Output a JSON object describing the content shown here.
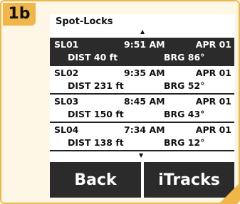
{
  "step": {
    "label": "1b"
  },
  "screen": {
    "title": "Spot-Locks",
    "rows": [
      {
        "id": "SL01",
        "time": "9:51 AM",
        "date": "APR 01",
        "dist": "DIST 40 ft",
        "brg": "BRG 86°",
        "selected": true
      },
      {
        "id": "SL02",
        "time": "9:35 AM",
        "date": "APR 01",
        "dist": "DIST 231 ft",
        "brg": "BRG 52°",
        "selected": false
      },
      {
        "id": "SL03",
        "time": "8:45 AM",
        "date": "APR 01",
        "dist": "DIST 150 ft",
        "brg": "BRG 43°",
        "selected": false
      },
      {
        "id": "SL04",
        "time": "7:34 AM",
        "date": "APR 01",
        "dist": "DIST 138 ft",
        "brg": "BRG 12°",
        "selected": false
      }
    ]
  },
  "softkeys": {
    "back_label": "Back",
    "itracks_label": "iTracks"
  },
  "icons": {
    "scroll_up": "scroll-up-arrow-icon",
    "scroll_down": "scroll-down-arrow-icon"
  },
  "colors": {
    "accent": "#f1b64a",
    "panel_background": "#fff7e6",
    "selection": "#2b2b2b"
  }
}
